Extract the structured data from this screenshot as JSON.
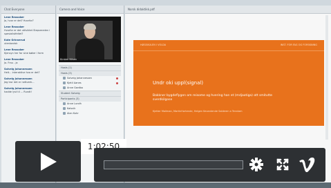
{
  "chat": {
    "header": "Chat  Everyone",
    "messages": [
      {
        "who": "Lene Reusaker",
        "text": "Ja, hvor er det? Hvorfor?"
      },
      {
        "who": "Lene Reusaker",
        "text": "Hvorfor er det utilsiktet Stepsmeden i spesialistfeltet?"
      },
      {
        "who": "Kate Grinnerud",
        "text": "utenlandsk"
      },
      {
        "who": "Lene Reusaker",
        "text": "Kjensyn her for sine bøker i form"
      },
      {
        "who": "Lene Reusaker",
        "text": "Ja. Frau - ja"
      },
      {
        "who": "Solveig Johannessen",
        "text": "Helt... interaktive hva er det?"
      },
      {
        "who": "Solveig Johannessen",
        "text": "Jeg tror det er nettverk..."
      },
      {
        "who": "Solveig Johannessen",
        "text": "hadde lyst til ... Rundt!"
      }
    ]
  },
  "participants": {
    "header": "Camera and Voice",
    "camera_label": "Kirsten Nilsen",
    "sections": [
      {
        "label": "Hosts (1)",
        "rows": []
      },
      {
        "label": "Hosts (3)",
        "rows": [
          {
            "name": "Solveig Johannessen",
            "flag": true
          },
          {
            "name": "Kjetil Aanes",
            "flag": true
          },
          {
            "name": "Anne Gardbo",
            "flag": false
          }
        ]
      },
      {
        "label": "Student Solveig",
        "rows": []
      },
      {
        "label": "Participants (3)",
        "rows": [
          {
            "name": "Anne Lundh",
            "flag": false
          },
          {
            "name": "Kalsvik",
            "flag": false
          },
          {
            "name": "Alan Kuhr",
            "flag": false
          }
        ]
      }
    ]
  },
  "main": {
    "header": "Norsk didaktikk.pdf",
    "slide": {
      "top_left": "HØGSKULEN I VOLDA",
      "top_right": "INST. FOR FAG OG FORSKNING",
      "title": "Undr oki uppl(signal)",
      "subtitle": "Bakkner bygdeflygen om reisome og hvering han et (mdjaotiga) ott smitutte sverdkilgose",
      "names": "Kjetter Mailman, MartinHortende, Helgen Kevantende Salderen a Tennlam"
    }
  },
  "player": {
    "timestamp": "1:02:50",
    "play_icon": "play-icon",
    "settings_icon": "gear-icon",
    "fullscreen_icon": "fullscreen-icon",
    "brand_icon": "vimeo-logo"
  }
}
